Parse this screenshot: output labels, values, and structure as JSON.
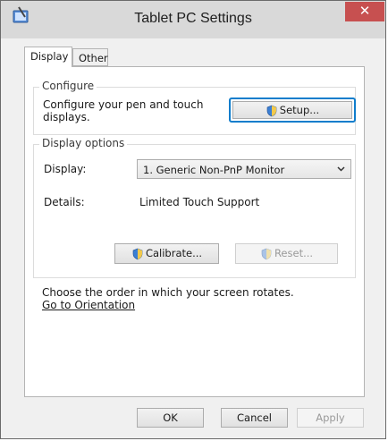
{
  "window": {
    "title": "Tablet PC Settings",
    "close_glyph": "✕"
  },
  "tabs": [
    {
      "label": "Display",
      "selected": true
    },
    {
      "label": "Other",
      "selected": false
    }
  ],
  "configure": {
    "legend": "Configure",
    "description": "Configure your pen and touch displays.",
    "setup_label": "Setup..."
  },
  "display_options": {
    "legend": "Display options",
    "display_label": "Display:",
    "display_value": "1. Generic Non-PnP Monitor",
    "details_label": "Details:",
    "details_value": "Limited Touch Support",
    "calibrate_label": "Calibrate...",
    "reset_label": "Reset..."
  },
  "orientation": {
    "text": "Choose the order in which your screen rotates.",
    "link": "Go to Orientation"
  },
  "footer": {
    "ok_label": "OK",
    "cancel_label": "Cancel",
    "apply_label": "Apply"
  },
  "colors": {
    "close_button": "#c75050",
    "focus_ring": "#0f7dcc",
    "link": "#0066cc"
  },
  "icons": {
    "app": "tablet-pen-icon",
    "shield": "uac-shield-icon",
    "dropdown": "chevron-down-icon"
  }
}
